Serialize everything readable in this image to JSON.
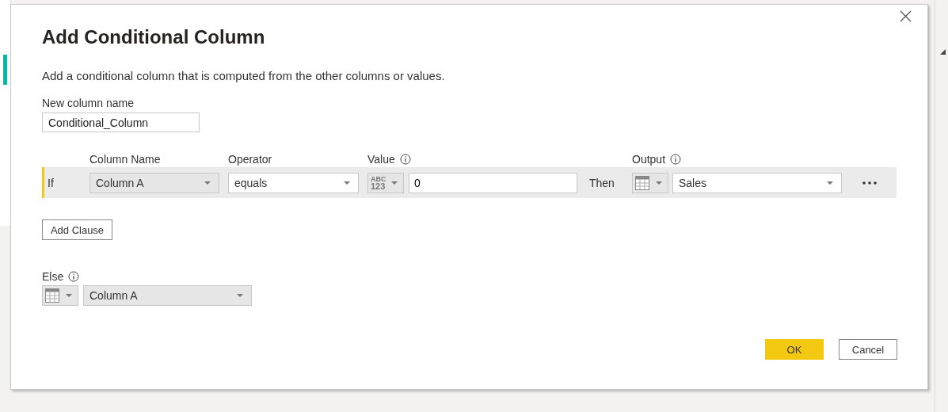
{
  "dialog": {
    "title": "Add Conditional Column",
    "description": "Add a conditional column that is computed from the other columns or values.",
    "new_column": {
      "label": "New column name",
      "value": "Conditional_Column"
    },
    "headers": [
      {
        "label": "Column Name",
        "info": false
      },
      {
        "label": "Operator",
        "info": false
      },
      {
        "label": "Value",
        "info": true
      },
      {
        "label": "Output",
        "info": true
      }
    ],
    "clauses": [
      {
        "keyword": "If",
        "column": "Column A",
        "operator": "equals",
        "value_type": [
          "ABC",
          "123"
        ],
        "value": "0",
        "then": "Then",
        "output": "Sales"
      }
    ],
    "add_clause": "Add Clause",
    "else": {
      "label": "Else",
      "info": true,
      "value": "Column A"
    },
    "buttons": [
      {
        "label": "OK",
        "kind": "primary"
      },
      {
        "label": "Cancel",
        "kind": "secondary"
      }
    ]
  }
}
